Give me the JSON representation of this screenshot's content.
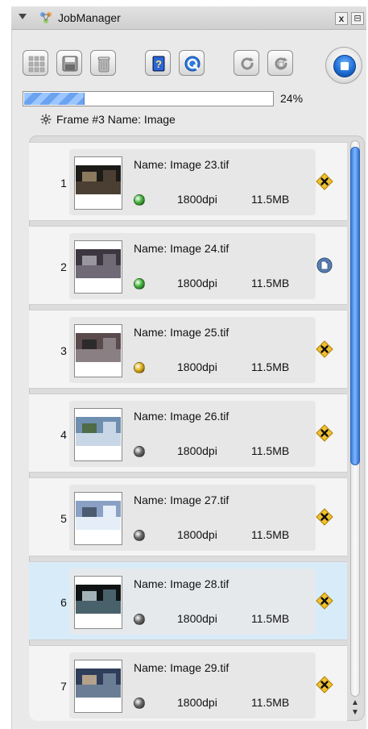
{
  "window": {
    "title": "JobManager",
    "close_glyph": "x",
    "menu_glyph": "⊟"
  },
  "toolbar": {
    "buttons": [
      {
        "name": "grid-button",
        "icon": "grid-icon"
      },
      {
        "name": "save-button",
        "icon": "floppy-disk-icon"
      },
      {
        "name": "trash-button",
        "icon": "trash-can-icon"
      },
      {
        "name": "help-button",
        "icon": "help-book-icon"
      },
      {
        "name": "preview-button",
        "icon": "quicktime-icon"
      },
      {
        "name": "refresh-button",
        "icon": "refresh-icon"
      },
      {
        "name": "refresh-alt-button",
        "icon": "refresh-alt-icon"
      },
      {
        "name": "stop-button",
        "icon": "stop-icon"
      }
    ]
  },
  "progress": {
    "value": 0.24,
    "label": "24%"
  },
  "current": {
    "label": "Frame #3 Name: Image"
  },
  "jobs": [
    {
      "index": "1",
      "name": "Name: Image 23.tif",
      "dpi": "1800dpi",
      "size": "11.5MB",
      "status": "green",
      "action": "cancel-icon"
    },
    {
      "index": "2",
      "name": "Name: Image 24.tif",
      "dpi": "1800dpi",
      "size": "11.5MB",
      "status": "green",
      "action": "document-icon"
    },
    {
      "index": "3",
      "name": "Name: Image 25.tif",
      "dpi": "1800dpi",
      "size": "11.5MB",
      "status": "yellow",
      "action": "cancel-icon"
    },
    {
      "index": "4",
      "name": "Name: Image 26.tif",
      "dpi": "1800dpi",
      "size": "11.5MB",
      "status": "gray",
      "action": "cancel-icon"
    },
    {
      "index": "5",
      "name": "Name: Image 27.tif",
      "dpi": "1800dpi",
      "size": "11.5MB",
      "status": "gray",
      "action": "cancel-icon"
    },
    {
      "index": "6",
      "name": "Name: Image 28.tif",
      "dpi": "1800dpi",
      "size": "11.5MB",
      "status": "gray",
      "action": "cancel-icon",
      "selected": true
    },
    {
      "index": "7",
      "name": "Name: Image 29.tif",
      "dpi": "1800dpi",
      "size": "11.5MB",
      "status": "gray",
      "action": "cancel-icon"
    }
  ],
  "colors": {
    "status_green": "#45b53c",
    "status_yellow": "#e2b21b",
    "status_gray": "#6a6a6a",
    "selected_row": "#d7ecf8",
    "accent_blue": "#2f78dd",
    "cancel_badge": "#f2c12f"
  }
}
